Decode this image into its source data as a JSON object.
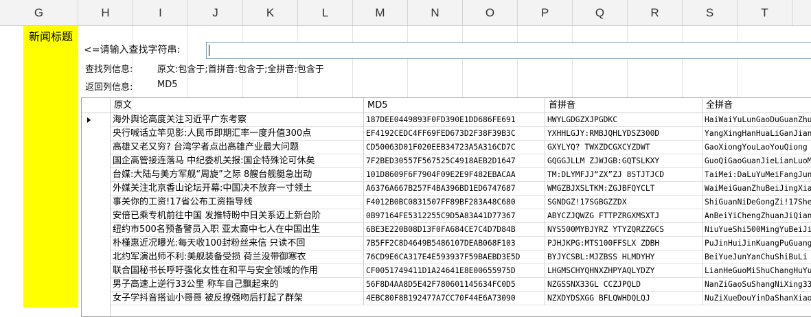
{
  "sheet_columns": [
    "G",
    "H",
    "I",
    "J",
    "K",
    "L",
    "M",
    "N",
    "O",
    "P",
    "Q",
    "R",
    "S",
    "T"
  ],
  "title_cell": "新闻标题",
  "prompt_label": "<=请输入查找字符串:",
  "search_value": "",
  "search_cols_label": "查找列信息:",
  "search_cols_value": "原文:包含于;首拼音:包含于;全拼音:包含于",
  "return_cols_label": "返回列信息:",
  "return_cols_value": "MD5",
  "grid": {
    "headers": [
      "原文",
      "MD5",
      "首拼音",
      "全拼音"
    ],
    "rows": [
      [
        "海外舆论高度关注习近平广东考察",
        "187DEE0449893F0FD390E1DD686FE691",
        "HWYLGDGZXJPGDKC",
        "HaiWaiYuLunGaoDuGuanZhu"
      ],
      [
        "央行喊话立竿见影:人民币即期汇率一度升值300点",
        "EF4192CEDC4FF69FED673D2F38F39B3C",
        "YXHHLGJY:RMBJQHLYDSZ300D",
        "YangXingHanHuaLiGanJian"
      ],
      [
        "高雄又老又穷? 台湾学者点出高雄产业最大问题",
        "CD50063D01F020EEB34723A5A316CD7C",
        "GXYLYQ? TWXZDCGXCYZDWT",
        "GaoXiongYouLaoYouQiong"
      ],
      [
        "国企高管接连落马 中纪委机关报:国企特殊论可休矣",
        "7F2BED30557F567525C4918AEB2D1647",
        "GQGGJLLM ZJWJGB:GQTSLKXY",
        "GuoQiGaoGuanJieLianLuoMa"
      ],
      [
        "台媒:大陆与美方军舰“周旋”之际 8艘台舰艇急出动",
        "101D8609F6F7904F09E2E9F482EBACAA",
        "TM:DLYMFJJ“ZX”ZJ 8STJTJCD",
        "TaiMei:DaLuYuMeiFangJun"
      ],
      [
        "外媒关注北京香山论坛开幕:中国决不放弃一寸领土",
        "A6376A667B257F4BA396BD1ED6747687",
        "WMGZBJXSLTKM:ZGJBFQYCLT",
        "WaiMeiGuanZhuBeiJingXiang"
      ],
      [
        "事关你的工资!17省公布工资指导线",
        "F4012B0BC0831507FF89BF283A48C680",
        "SGNDGZ!17SGBGZZDX",
        "ShiGuanNiDeGongZi!17Sheng"
      ],
      [
        "安倍已乘专机前往中国 发推特盼中日关系迈上新台阶",
        "0B97164FE5312255C9D5A83A41D77367",
        "ABYCZJQWZG FTTPZRGXMSXTJ",
        "AnBeiYiChengZhuanJiQianWang"
      ],
      [
        "纽约市500名预备警员入职 亚太裔中七人在中国出生",
        "6BE3E220B08D13F0FA684CE7C4D7D84B",
        "NYS500MYBJYRZ YTYZQRZZGCS",
        "NiuYueShi500MingYuBeiJing"
      ],
      [
        "朴槿惠近况曝光:每天收100封粉丝来信 只读不回",
        "7B5FF2C8D4649B5486107DEAB068F103",
        "PJHJKPG:MTS100FFSLX ZDBH",
        "PuJinHuiJinKuangPuGuang"
      ],
      [
        "北约军演出师不利:美舰装备受损 荷兰没带御寒衣",
        "76CD9E6CA317E4E593937F59BAEBD3E5D",
        "BYJYCSBL:MJZBSS HLMDYHY",
        "BeiYueJunYanChuShiBuLi"
      ],
      [
        "联合国秘书长呼吁强化女性在和平与安全领域的作用",
        "CF0051749411D1A24641E8E00655975D",
        "LHGMSCHYQHNXZHPYAQLYDZY",
        "LianHeGuoMiShuChangHuYu"
      ],
      [
        "男子高速上逆行33公里 称车自己飘起来的",
        "56F8D4AA8D5E42F780601145634FC0D5",
        "NZGSSNX33GL CCZJPQLD",
        "NanZiGaoSuShangNiXing33"
      ],
      [
        "女子学抖音搭讪小哥哥 被反撩强吻后打起了群架",
        "4EBC80F8B192477A7CC70F44E6A73090",
        "NZXDYDSXGG BFLQWHDQLQJ",
        "NuZiXueDouYinDaShanXiao"
      ]
    ]
  }
}
